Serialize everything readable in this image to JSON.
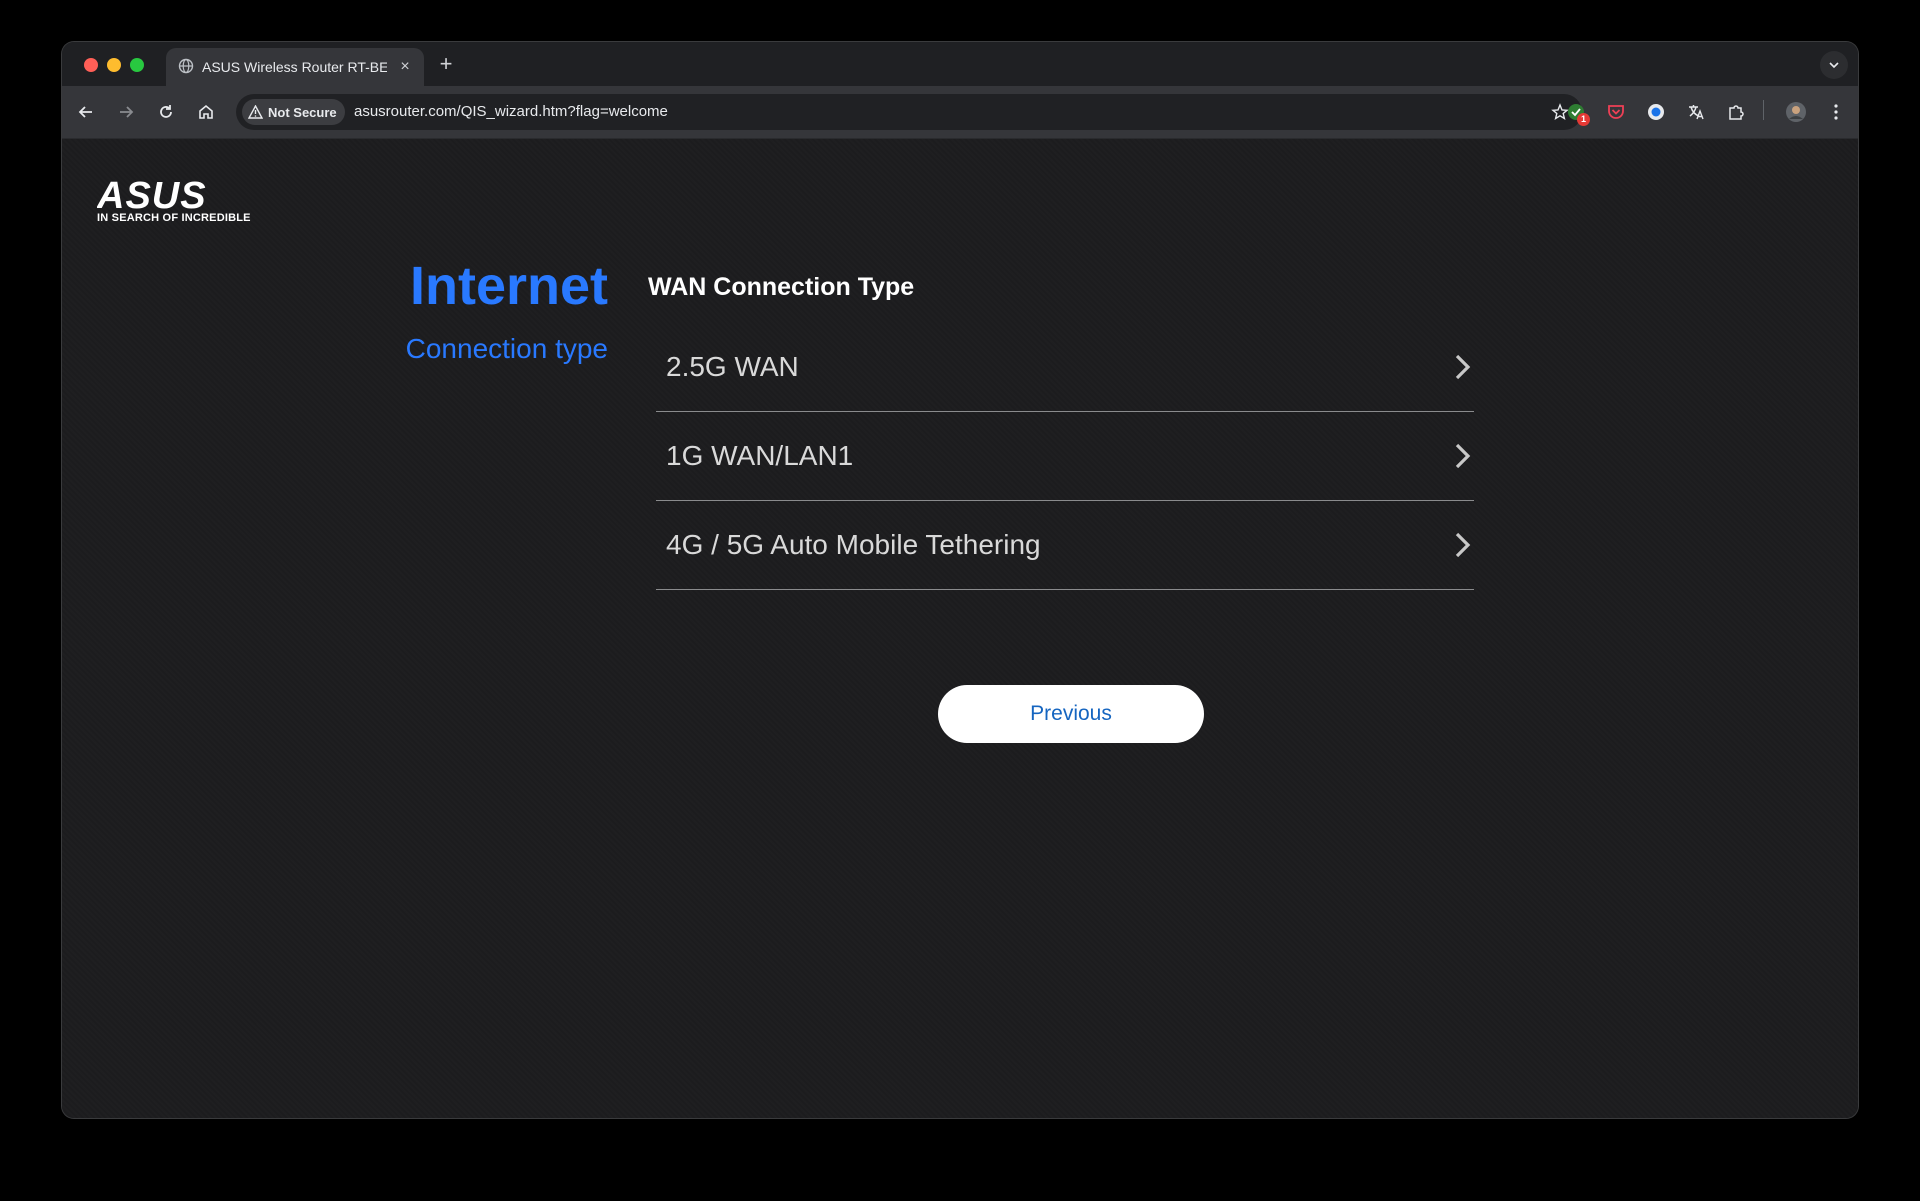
{
  "browser": {
    "tab_title": "ASUS Wireless Router RT-BE",
    "tab_close": "×",
    "new_tab": "+",
    "security_label": "Not Secure",
    "url": "asusrouter.com/QIS_wizard.htm?flag=welcome",
    "extension_badge": "1"
  },
  "brand": {
    "logo_text": "ASUS",
    "tagline": "IN SEARCH OF INCREDIBLE"
  },
  "sidebar": {
    "title": "Internet",
    "subtitle": "Connection type"
  },
  "main": {
    "section_title": "WAN Connection Type",
    "options": [
      {
        "label": "2.5G WAN"
      },
      {
        "label": "1G WAN/LAN1"
      },
      {
        "label": "4G / 5G Auto Mobile Tethering"
      }
    ],
    "previous_label": "Previous"
  },
  "colors": {
    "accent_blue": "#2979ff",
    "button_text": "#1565c0",
    "page_bg": "#1c1c1e"
  }
}
